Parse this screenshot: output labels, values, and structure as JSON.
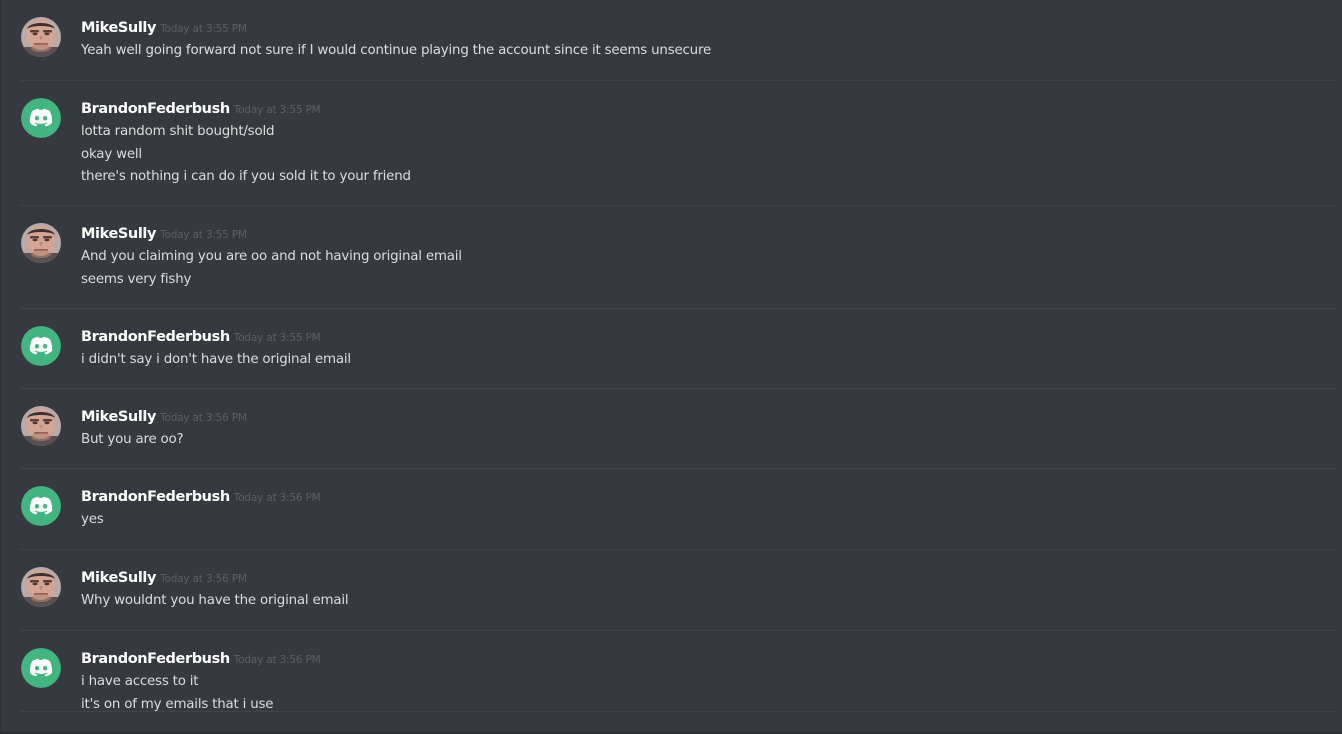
{
  "colors": {
    "background": "#36393f",
    "username": "#ffffff",
    "timestamp": "#5c5f66",
    "message_text": "#dcddde",
    "discord_avatar_bg": "#43b581"
  },
  "messages": [
    {
      "author": "MikeSully",
      "timestamp": "Today at 3:55 PM",
      "avatar": "photo-avatar",
      "lines": [
        "Yeah well going forward not sure if I would continue playing the account since it seems unsecure"
      ]
    },
    {
      "author": "BrandonFederbush",
      "timestamp": "Today at 3:55 PM",
      "avatar": "discord-logo-avatar",
      "lines": [
        "lotta random shit bought/sold",
        "okay well",
        "there's nothing i can do if you sold it to your friend"
      ]
    },
    {
      "author": "MikeSully",
      "timestamp": "Today at 3:55 PM",
      "avatar": "photo-avatar",
      "lines": [
        "And you claiming you are oo and not having original email",
        "seems very fishy"
      ]
    },
    {
      "author": "BrandonFederbush",
      "timestamp": "Today at 3:55 PM",
      "avatar": "discord-logo-avatar",
      "lines": [
        "i didn't say i don't have the original email"
      ]
    },
    {
      "author": "MikeSully",
      "timestamp": "Today at 3:56 PM",
      "avatar": "photo-avatar",
      "lines": [
        "But you are oo?"
      ]
    },
    {
      "author": "BrandonFederbush",
      "timestamp": "Today at 3:56 PM",
      "avatar": "discord-logo-avatar",
      "lines": [
        "yes"
      ]
    },
    {
      "author": "MikeSully",
      "timestamp": "Today at 3:56 PM",
      "avatar": "photo-avatar",
      "lines": [
        "Why wouldnt you have the original email"
      ]
    },
    {
      "author": "BrandonFederbush",
      "timestamp": "Today at 3:56 PM",
      "avatar": "discord-logo-avatar",
      "lines": [
        "i have access to it",
        "it's on of my emails that i use"
      ]
    }
  ]
}
